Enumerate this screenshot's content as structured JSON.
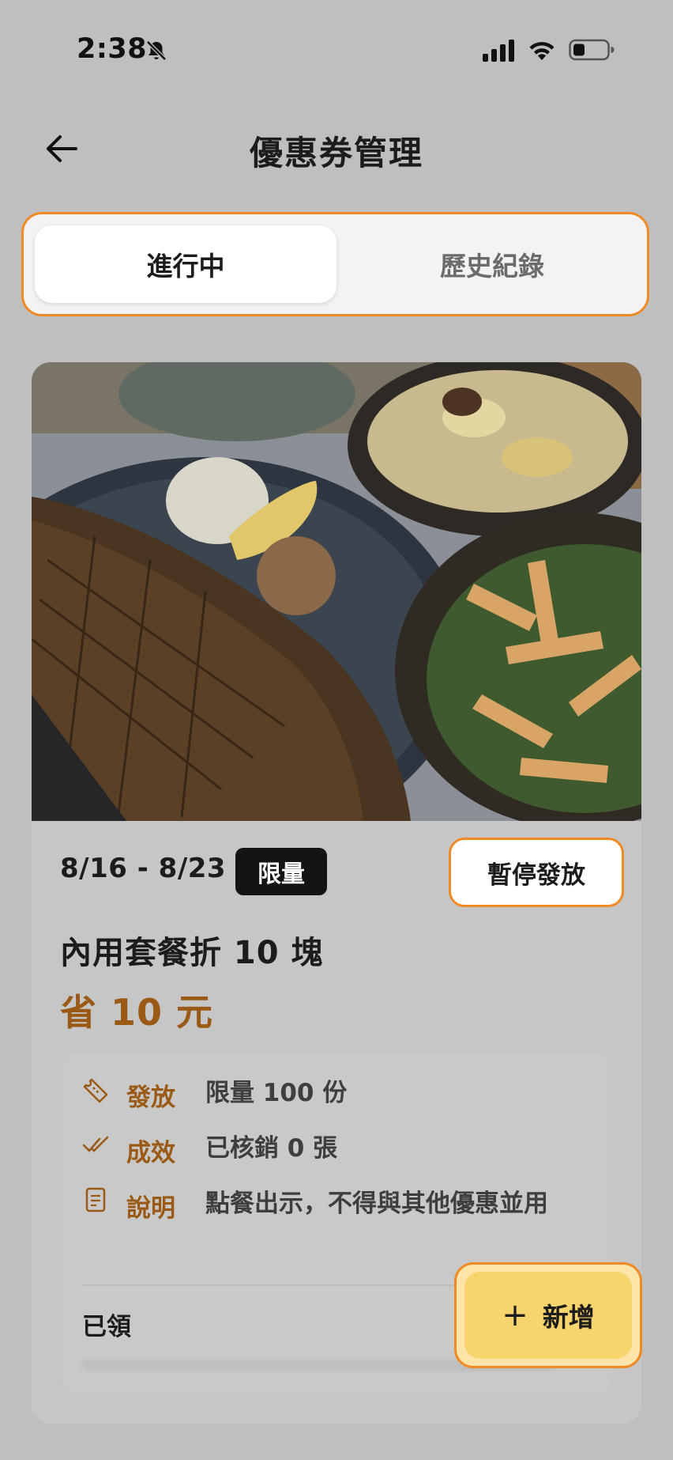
{
  "status_bar": {
    "time": "2:38"
  },
  "header": {
    "title": "優惠券管理"
  },
  "tabs": [
    {
      "label": "進行中"
    },
    {
      "label": "歷史紀錄"
    }
  ],
  "coupon": {
    "date_range": "8/16 - 8/23",
    "badge": "限量",
    "pause_label": "暫停發放",
    "title": "內用套餐折 10 塊",
    "save": "省 10 元",
    "details": [
      {
        "key": "發放",
        "value": "限量 100 份",
        "icon": "ticket-icon"
      },
      {
        "key": "成效",
        "value": "已核銷 0 張",
        "icon": "double-check-icon"
      },
      {
        "key": "說明",
        "value": "點餐出示，不得與其他優惠並用",
        "icon": "document-icon"
      }
    ],
    "claimed_label": "已領"
  },
  "fab": {
    "label": "新增"
  },
  "colors": {
    "accent": "#f08a24",
    "brand_brown": "#9a5a16",
    "fab_yellow": "#f7d46c"
  }
}
